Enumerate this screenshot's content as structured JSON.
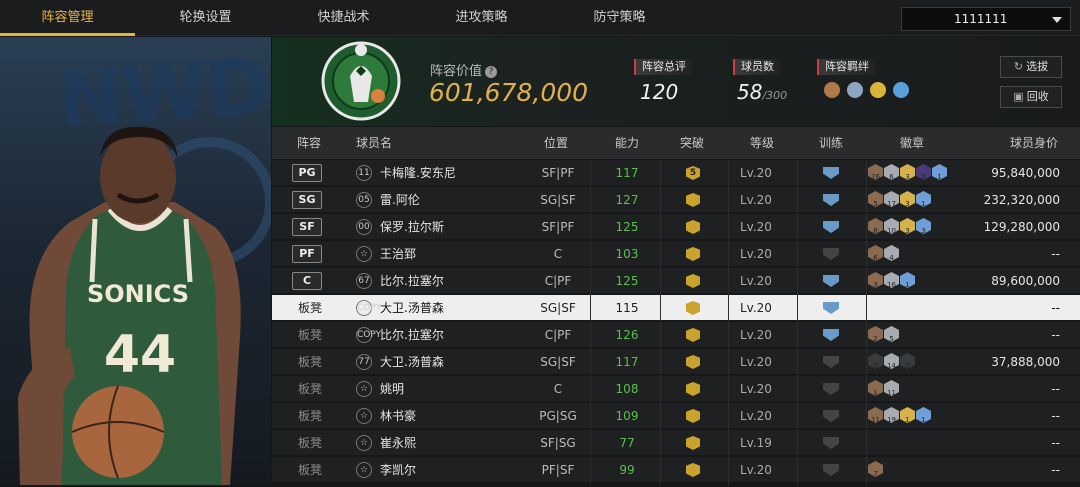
{
  "tabs": [
    "阵容管理",
    "轮换设置",
    "快捷战术",
    "进攻策略",
    "防守策略"
  ],
  "account": {
    "value": "1111111"
  },
  "team": {
    "value_label": "阵容价值",
    "value": "601,678,000",
    "logo_text": "BOSTON CELTICS"
  },
  "stats": [
    {
      "label": "阵容总评",
      "value": "120",
      "suffix": ""
    },
    {
      "label": "球员数",
      "value": "58",
      "suffix": "/300"
    },
    {
      "label": "阵容羁绊",
      "value": "",
      "suffix": ""
    }
  ],
  "buttons": {
    "select": "选拔",
    "recycle": "回收"
  },
  "headers": [
    "阵容",
    "球员名",
    "位置",
    "能力",
    "突破",
    "等级",
    "训练",
    "徽章",
    "球员身价"
  ],
  "colors": {
    "accent": "#e8b53a",
    "ability_green": "#59c04e",
    "bronze": "#8a6a50",
    "silver": "#a8acb2",
    "gold": "#d7b24a",
    "sapphire": "#6f9ed8",
    "amethyst": "#4a3a78",
    "dark": "#3a3a3a"
  },
  "players": [
    {
      "role": "PG",
      "starter": true,
      "jersey": "11",
      "name": "卡梅隆.安东尼",
      "pos": "SF|PF",
      "ability": "117",
      "breakthrough": "5",
      "level": "Lv.20",
      "trained": true,
      "badges": [
        {
          "t": "bronze",
          "v": "26"
        },
        {
          "t": "silver",
          "v": "6"
        },
        {
          "t": "gold",
          "v": "3"
        },
        {
          "t": "amethyst",
          "v": "0"
        },
        {
          "t": "sapphire",
          "v": "1"
        }
      ],
      "price": "95,840,000"
    },
    {
      "role": "SG",
      "starter": true,
      "jersey": "05",
      "name": "雷.阿伦",
      "pos": "SG|SF",
      "ability": "127",
      "breakthrough": "",
      "level": "Lv.20",
      "trained": true,
      "badges": [
        {
          "t": "bronze",
          "v": "5"
        },
        {
          "t": "silver",
          "v": "17"
        },
        {
          "t": "gold",
          "v": "3"
        },
        {
          "t": "sapphire",
          "v": "1"
        }
      ],
      "price": "232,320,000"
    },
    {
      "role": "SF",
      "starter": true,
      "jersey": "00",
      "name": "保罗.拉尔斯",
      "pos": "SF|PF",
      "ability": "125",
      "breakthrough": "",
      "level": "Lv.20",
      "trained": true,
      "badges": [
        {
          "t": "bronze",
          "v": "8"
        },
        {
          "t": "silver",
          "v": "10"
        },
        {
          "t": "gold",
          "v": "3"
        },
        {
          "t": "sapphire",
          "v": "3"
        }
      ],
      "price": "129,280,000"
    },
    {
      "role": "PF",
      "starter": true,
      "jersey": "☆",
      "name": "王治郅",
      "pos": "C",
      "ability": "103",
      "breakthrough": "",
      "level": "Lv.20",
      "trained": false,
      "badges": [
        {
          "t": "bronze",
          "v": "6"
        },
        {
          "t": "silver",
          "v": "4"
        }
      ],
      "price": "--"
    },
    {
      "role": "C",
      "starter": true,
      "jersey": "67",
      "name": "比尔.拉塞尔",
      "pos": "C|PF",
      "ability": "125",
      "breakthrough": "",
      "level": "Lv.20",
      "trained": true,
      "badges": [
        {
          "t": "bronze",
          "v": "3"
        },
        {
          "t": "silver",
          "v": "16"
        },
        {
          "t": "sapphire",
          "v": "1"
        }
      ],
      "price": "89,600,000"
    },
    {
      "role": "板凳",
      "starter": false,
      "jersey": "COPY",
      "name": "大卫.汤普森",
      "pos": "SG|SF",
      "ability": "115",
      "breakthrough": "",
      "level": "Lv.20",
      "trained": true,
      "badges": [],
      "price": "--"
    },
    {
      "role": "板凳",
      "starter": false,
      "jersey": "COPY",
      "name": "比尔.拉塞尔",
      "pos": "C|PF",
      "ability": "126",
      "breakthrough": "",
      "level": "Lv.20",
      "trained": true,
      "badges": [
        {
          "t": "bronze",
          "v": "2"
        },
        {
          "t": "silver",
          "v": "5"
        }
      ],
      "price": "--"
    },
    {
      "role": "板凳",
      "starter": false,
      "jersey": "77",
      "name": "大卫.汤普森",
      "pos": "SG|SF",
      "ability": "117",
      "breakthrough": "",
      "level": "Lv.20",
      "trained": false,
      "badges": [
        {
          "t": "dark",
          "v": "0"
        },
        {
          "t": "silver",
          "v": "14"
        },
        {
          "t": "dark",
          "v": "0"
        }
      ],
      "price": "37,888,000"
    },
    {
      "role": "板凳",
      "starter": false,
      "jersey": "☆",
      "name": "姚明",
      "pos": "C",
      "ability": "108",
      "breakthrough": "",
      "level": "Lv.20",
      "trained": false,
      "badges": [
        {
          "t": "bronze",
          "v": "1"
        },
        {
          "t": "silver",
          "v": "11"
        }
      ],
      "price": "--"
    },
    {
      "role": "板凳",
      "starter": false,
      "jersey": "☆",
      "name": "林书豪",
      "pos": "PG|SG",
      "ability": "109",
      "breakthrough": "",
      "level": "Lv.20",
      "trained": false,
      "badges": [
        {
          "t": "bronze",
          "v": "11"
        },
        {
          "t": "silver",
          "v": "19"
        },
        {
          "t": "gold",
          "v": "1"
        },
        {
          "t": "sapphire",
          "v": "1"
        }
      ],
      "price": "--"
    },
    {
      "role": "板凳",
      "starter": false,
      "jersey": "☆",
      "name": "崔永熙",
      "pos": "SF|SG",
      "ability": "77",
      "breakthrough": "",
      "level": "Lv.19",
      "trained": false,
      "badges": [],
      "price": "--"
    },
    {
      "role": "板凳",
      "starter": false,
      "jersey": "☆",
      "name": "李凯尔",
      "pos": "PF|SF",
      "ability": "99",
      "breakthrough": "",
      "level": "Lv.20",
      "trained": false,
      "badges": [
        {
          "t": "bronze",
          "v": "7"
        }
      ],
      "price": "--"
    }
  ],
  "selected_row": 5,
  "art": {
    "jersey_text": "SONICS",
    "jersey_number": "44",
    "background_text": "NWDE"
  }
}
